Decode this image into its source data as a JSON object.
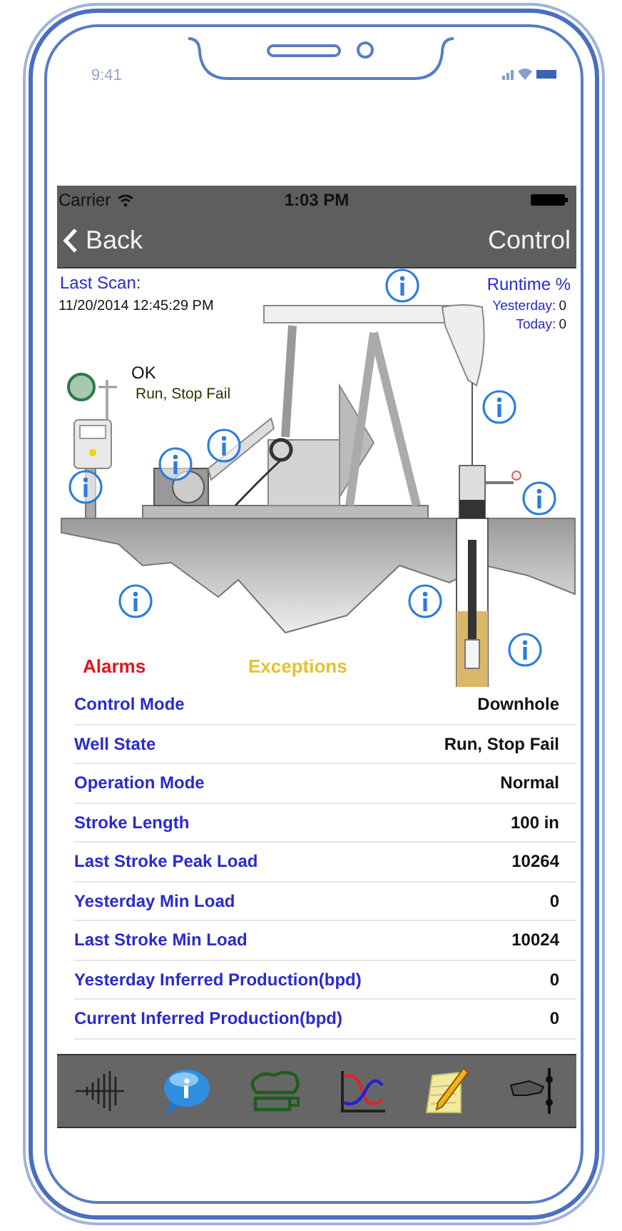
{
  "device": {
    "time": "9:41"
  },
  "status_bar": {
    "carrier": "Carrier",
    "time": "1:03 PM"
  },
  "nav": {
    "back": "Back",
    "title": "Control"
  },
  "diagram": {
    "last_scan_label": "Last Scan:",
    "last_scan": "11/20/2014 12:45:29 PM",
    "runtime_label": "Runtime %",
    "runtime": [
      {
        "label": "Yesterday:",
        "value": "0"
      },
      {
        "label": "Today:",
        "value": "0"
      }
    ],
    "status": "OK",
    "well_state": "Run, Stop Fail",
    "alarms": "Alarms",
    "exceptions": "Exceptions"
  },
  "rows": [
    {
      "label": "Control Mode",
      "value": "Downhole"
    },
    {
      "label": "Well State",
      "value": "Run, Stop Fail"
    },
    {
      "label": "Operation Mode",
      "value": "Normal"
    },
    {
      "label": "Stroke Length",
      "value": "100 in"
    },
    {
      "label": "Last Stroke Peak Load",
      "value": "10264"
    },
    {
      "label": "Yesterday Min Load",
      "value": "0"
    },
    {
      "label": "Last Stroke Min Load",
      "value": "10024"
    },
    {
      "label": "Yesterday Inferred Production(bpd)",
      "value": "0"
    },
    {
      "label": "Current Inferred Production(bpd)",
      "value": "0"
    }
  ]
}
